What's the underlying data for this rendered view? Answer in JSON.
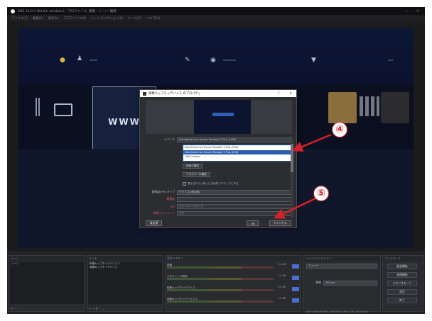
{
  "callouts": {
    "four": "④",
    "five": "⑤"
  },
  "window": {
    "icon": "obs-icon",
    "title": "OBS 24.0.3 (64-bit, windows) - プロファイル: 無題 - シーン: 無題",
    "minimize": "—",
    "close": "✕",
    "menu": [
      "ファイル(F)",
      "編集(E)",
      "表示(V)",
      "プロファイル(P)",
      "シーンコレクション(S)",
      "ツール(T)",
      "ヘルプ(H)"
    ]
  },
  "dialog": {
    "title": "映像キャプチャデバイス のプロパティ",
    "help": "?",
    "close": "✕",
    "device_label": "デバイス",
    "device_options": [
      "AVerMedia Live Gamer Portable 2 Plus (USB)",
      "AVerMedia Live Gamer Portable 2 Plus (USB)",
      "OBS-Camera"
    ],
    "configure_button": "映像の構成",
    "crossbar_button": "クロスバーの構成",
    "deactivate_checkbox": "表示されていないときは非アクティブにする",
    "resolution_label": "解像度/FPS タイプ",
    "resolution_value": "デバイスの既定値",
    "res_sub_label": "解像度",
    "fps_label": "FPS",
    "fps_value": "出力 FPS に合わせる",
    "video_format_label": "映像フォーマット",
    "video_format_value": "任意",
    "defaults_button": "既定値",
    "ok_button": "OK",
    "cancel_button": "キャンセル"
  },
  "docks": {
    "scenes_header": "シーン",
    "scenes": [
      "シーン"
    ],
    "sources_header": "ソース",
    "sources": [
      "映像キャプチャデバイス 2",
      "映像キャプチャデバイス"
    ],
    "mixer_header": "音声ミキサー",
    "mixer": [
      {
        "name": "映像",
        "db": "0.0 dB"
      },
      {
        "name": "デスクトップ音声",
        "db": "0.0 dB"
      },
      {
        "name": "映像キャプチャデバイス",
        "db": "0.0 dB"
      },
      {
        "name": "映像キャプチャデバイス 2",
        "db": "0.0 dB"
      }
    ],
    "transitions_header": "シーントランジション",
    "transition_value": "フェード",
    "duration_label": "期間",
    "duration_value": "300 ms",
    "controls_header": "コントロール",
    "controls": [
      "配信開始",
      "録画開始",
      "スタジオモード",
      "設定",
      "終了"
    ],
    "status": "LIVE: 00:00:00  REC: 00:00:00  CPU: 0.7%, 30.00 fps"
  },
  "colors": {
    "callout_red": "#d6202a",
    "selection_blue": "#2a5db0"
  }
}
